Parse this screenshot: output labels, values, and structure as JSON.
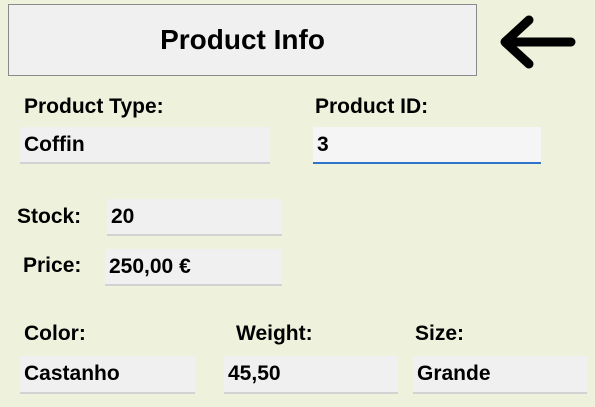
{
  "header": {
    "title": "Product Info",
    "back_icon": "arrow-left-icon"
  },
  "product_type": {
    "label": "Product Type:",
    "value": "Coffin"
  },
  "product_id": {
    "label": "Product ID:",
    "value": "3"
  },
  "stock": {
    "label": "Stock:",
    "value": "20"
  },
  "price": {
    "label": "Price:",
    "value": "250,00 €"
  },
  "color": {
    "label": "Color:",
    "value": "Castanho"
  },
  "weight": {
    "label": "Weight:",
    "value": "45,50"
  },
  "size": {
    "label": "Size:",
    "value": "Grande"
  }
}
